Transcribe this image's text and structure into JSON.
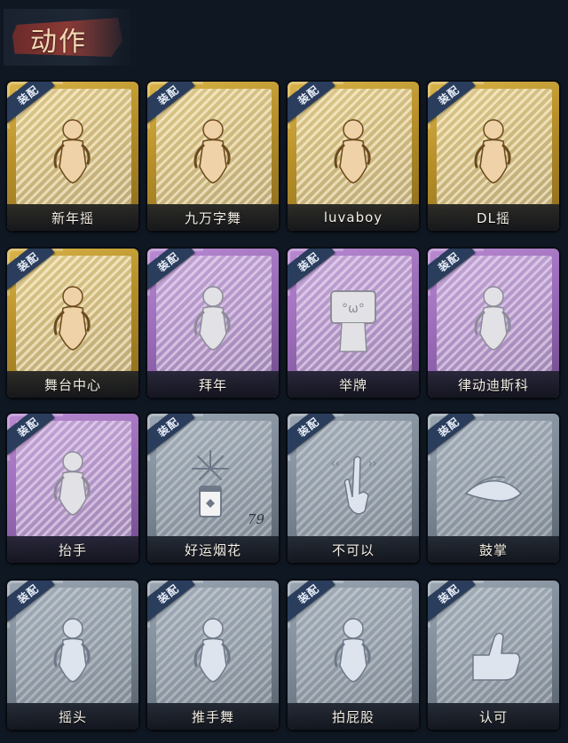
{
  "header": {
    "title": "动作"
  },
  "equip_label": "装配",
  "cards": [
    {
      "label": "新年摇",
      "tier": "gold",
      "icon": "dance-figure-icon"
    },
    {
      "label": "九万字舞",
      "tier": "gold",
      "icon": "dance-figure-icon"
    },
    {
      "label": "luvaboy",
      "tier": "gold",
      "icon": "dance-figure-icon"
    },
    {
      "label": "DL摇",
      "tier": "gold",
      "icon": "dance-figure-icon"
    },
    {
      "label": "舞台中心",
      "tier": "gold",
      "icon": "dance-figure-icon"
    },
    {
      "label": "拜年",
      "tier": "purple",
      "icon": "bow-figure-icon"
    },
    {
      "label": "举牌",
      "tier": "purple",
      "icon": "sign-holding-icon"
    },
    {
      "label": "律动迪斯科",
      "tier": "purple",
      "icon": "disco-figure-icon"
    },
    {
      "label": "抬手",
      "tier": "purple",
      "icon": "raise-hand-figure-icon"
    },
    {
      "label": "好运烟花",
      "tier": "silver",
      "icon": "firework-icon",
      "count": "79"
    },
    {
      "label": "不可以",
      "tier": "silver",
      "icon": "finger-wag-icon"
    },
    {
      "label": "鼓掌",
      "tier": "silver",
      "icon": "clap-icon"
    },
    {
      "label": "摇头",
      "tier": "silver",
      "icon": "head-shake-figure-icon"
    },
    {
      "label": "推手舞",
      "tier": "silver",
      "icon": "push-dance-figure-icon"
    },
    {
      "label": "拍屁股",
      "tier": "silver",
      "icon": "spank-figure-icon"
    },
    {
      "label": "认可",
      "tier": "silver",
      "icon": "thumbs-up-icon"
    }
  ],
  "colors": {
    "background": "#0f1722",
    "gold": "#c9a238",
    "purple": "#9a6bb8",
    "silver": "#7d8996",
    "ribbon": "#2a3d5c"
  }
}
